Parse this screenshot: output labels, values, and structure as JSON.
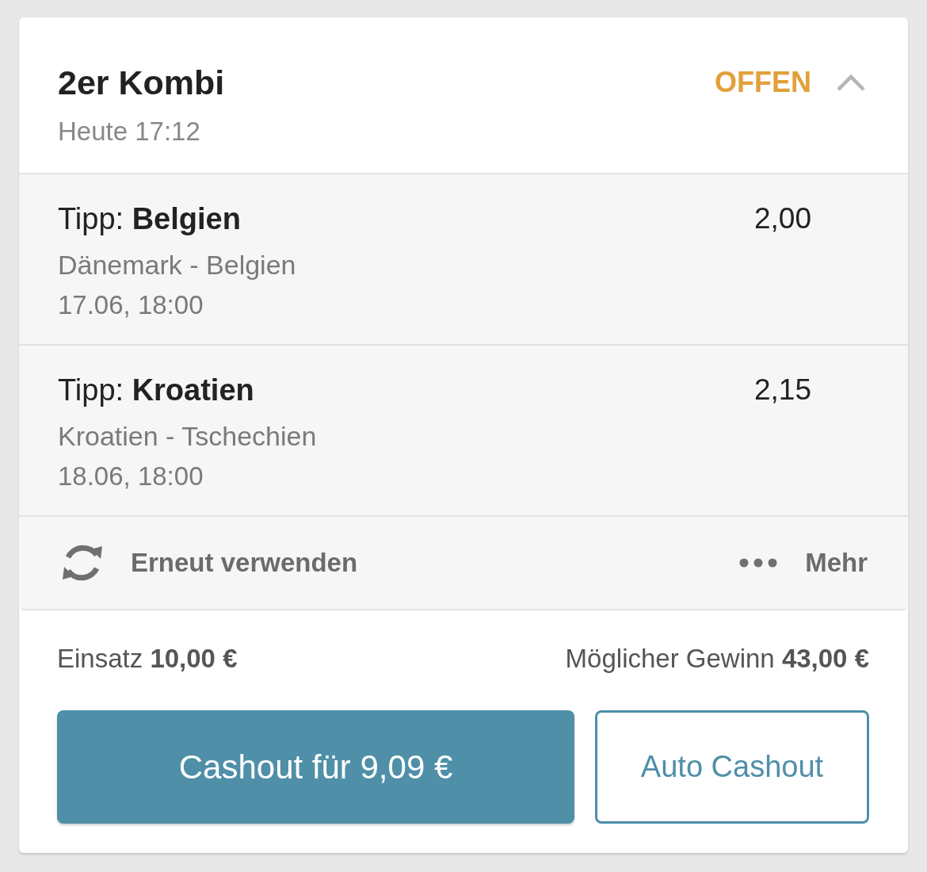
{
  "bet": {
    "title": "2er Kombi",
    "time": "Heute 17:12",
    "status": "OFFEN",
    "expanded": true
  },
  "selections": [
    {
      "tip": "Tipp: **Belgien**",
      "match": "Dänemark - Belgien",
      "date": "17.06, 18:00",
      "odds": "2,00"
    },
    {
      "tip": "Tipp: **Kroatien**",
      "match": "Kroatien - Tschechien",
      "date": "18.06, 18:00",
      "odds": "2,15"
    }
  ],
  "actions": {
    "reuse": "Erneut verwenden",
    "more": "Mehr"
  },
  "summary": {
    "stake": "Einsatz **10,00 €**",
    "potential_win": "Möglicher Gewinn **43,00 €**"
  },
  "buttons": [
    {
      "label": "Cashout für 9,09 €",
      "kind": "primary"
    },
    {
      "label": "Auto Cashout",
      "kind": "outline"
    }
  ]
}
